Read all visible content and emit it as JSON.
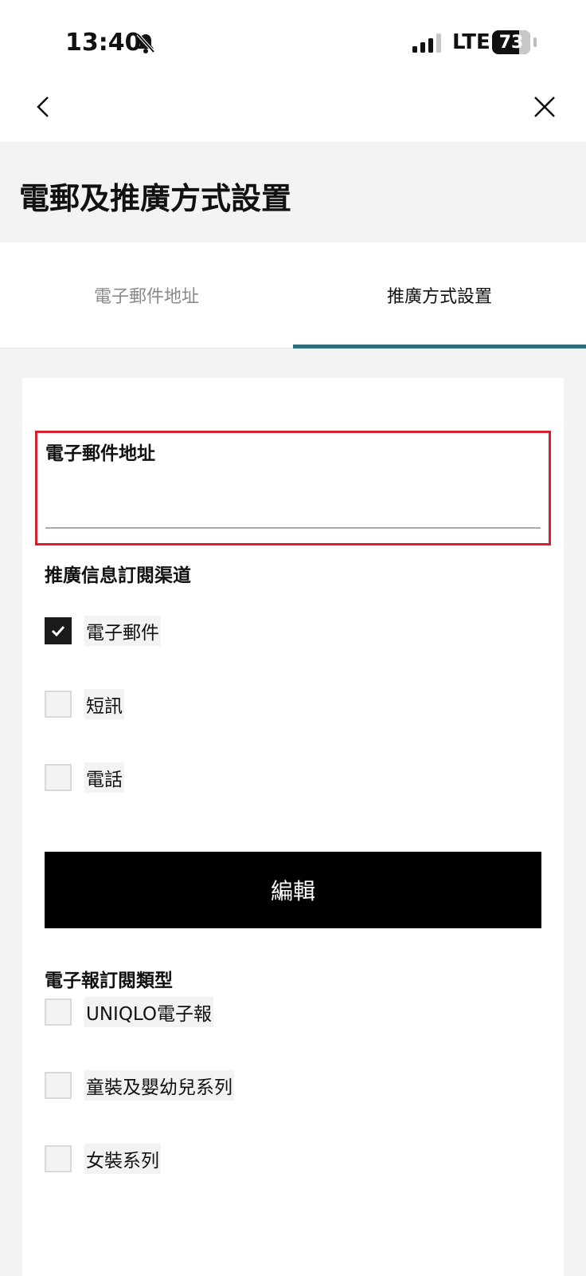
{
  "status_bar": {
    "time": "13:40",
    "network": "LTE",
    "battery": "73"
  },
  "page": {
    "title": "電郵及推廣方式設置"
  },
  "tabs": [
    {
      "label": "電子郵件地址",
      "active": false
    },
    {
      "label": "推廣方式設置",
      "active": true
    }
  ],
  "email_field": {
    "label": "電子郵件地址",
    "value": ""
  },
  "channels": {
    "heading": "推廣信息訂閱渠道",
    "items": [
      {
        "label": "電子郵件",
        "checked": true
      },
      {
        "label": "短訊",
        "checked": false
      },
      {
        "label": "電話",
        "checked": false
      }
    ]
  },
  "edit_button": {
    "label": "編輯"
  },
  "newsletter": {
    "heading": "電子報訂閱類型",
    "items": [
      {
        "label": "UNIQLO電子報",
        "checked": false
      },
      {
        "label": "童裝及嬰幼兒系列",
        "checked": false
      },
      {
        "label": "女裝系列",
        "checked": false
      }
    ]
  },
  "colors": {
    "accent": "#2f6f7c",
    "highlight_border": "#d92030",
    "button": "#000000"
  }
}
